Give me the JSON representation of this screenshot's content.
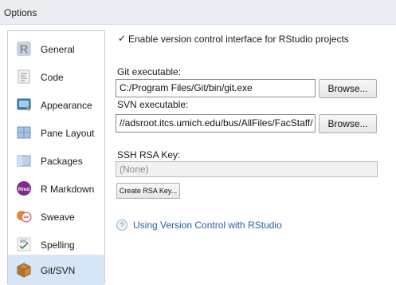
{
  "window": {
    "title": "Options"
  },
  "sidebar": {
    "items": [
      {
        "label": "General",
        "icon": "r-logo-icon"
      },
      {
        "label": "Code",
        "icon": "code-document-icon"
      },
      {
        "label": "Appearance",
        "icon": "appearance-paint-icon"
      },
      {
        "label": "Pane Layout",
        "icon": "pane-layout-icon"
      },
      {
        "label": "Packages",
        "icon": "packages-icon"
      },
      {
        "label": "R Markdown",
        "icon": "rmarkdown-icon"
      },
      {
        "label": "Sweave",
        "icon": "sweave-icon"
      },
      {
        "label": "Spelling",
        "icon": "spelling-abc-icon"
      },
      {
        "label": "Git/SVN",
        "icon": "git-box-icon"
      }
    ],
    "selected": "Git/SVN",
    "selected_color": "#d6e6f6"
  },
  "vcs": {
    "enable_checked": true,
    "check_mark": "✓",
    "enable_label": "Enable version control interface for RStudio projects",
    "git_label": "Git executable:",
    "git_value": "C:/Program Files/Git/bin/git.exe",
    "svn_label": "SVN executable:",
    "svn_value": "//adsroot.itcs.umich.edu/bus/AllFiles/FacStaff/",
    "browse_label": "Browse...",
    "ssh_label": "SSH RSA Key:",
    "ssh_value": "(None)",
    "create_key_label": "Create RSA Key...",
    "help_icon": "?",
    "help_link": "Using Version Control with RStudio",
    "link_color": "#2a5fa0"
  }
}
